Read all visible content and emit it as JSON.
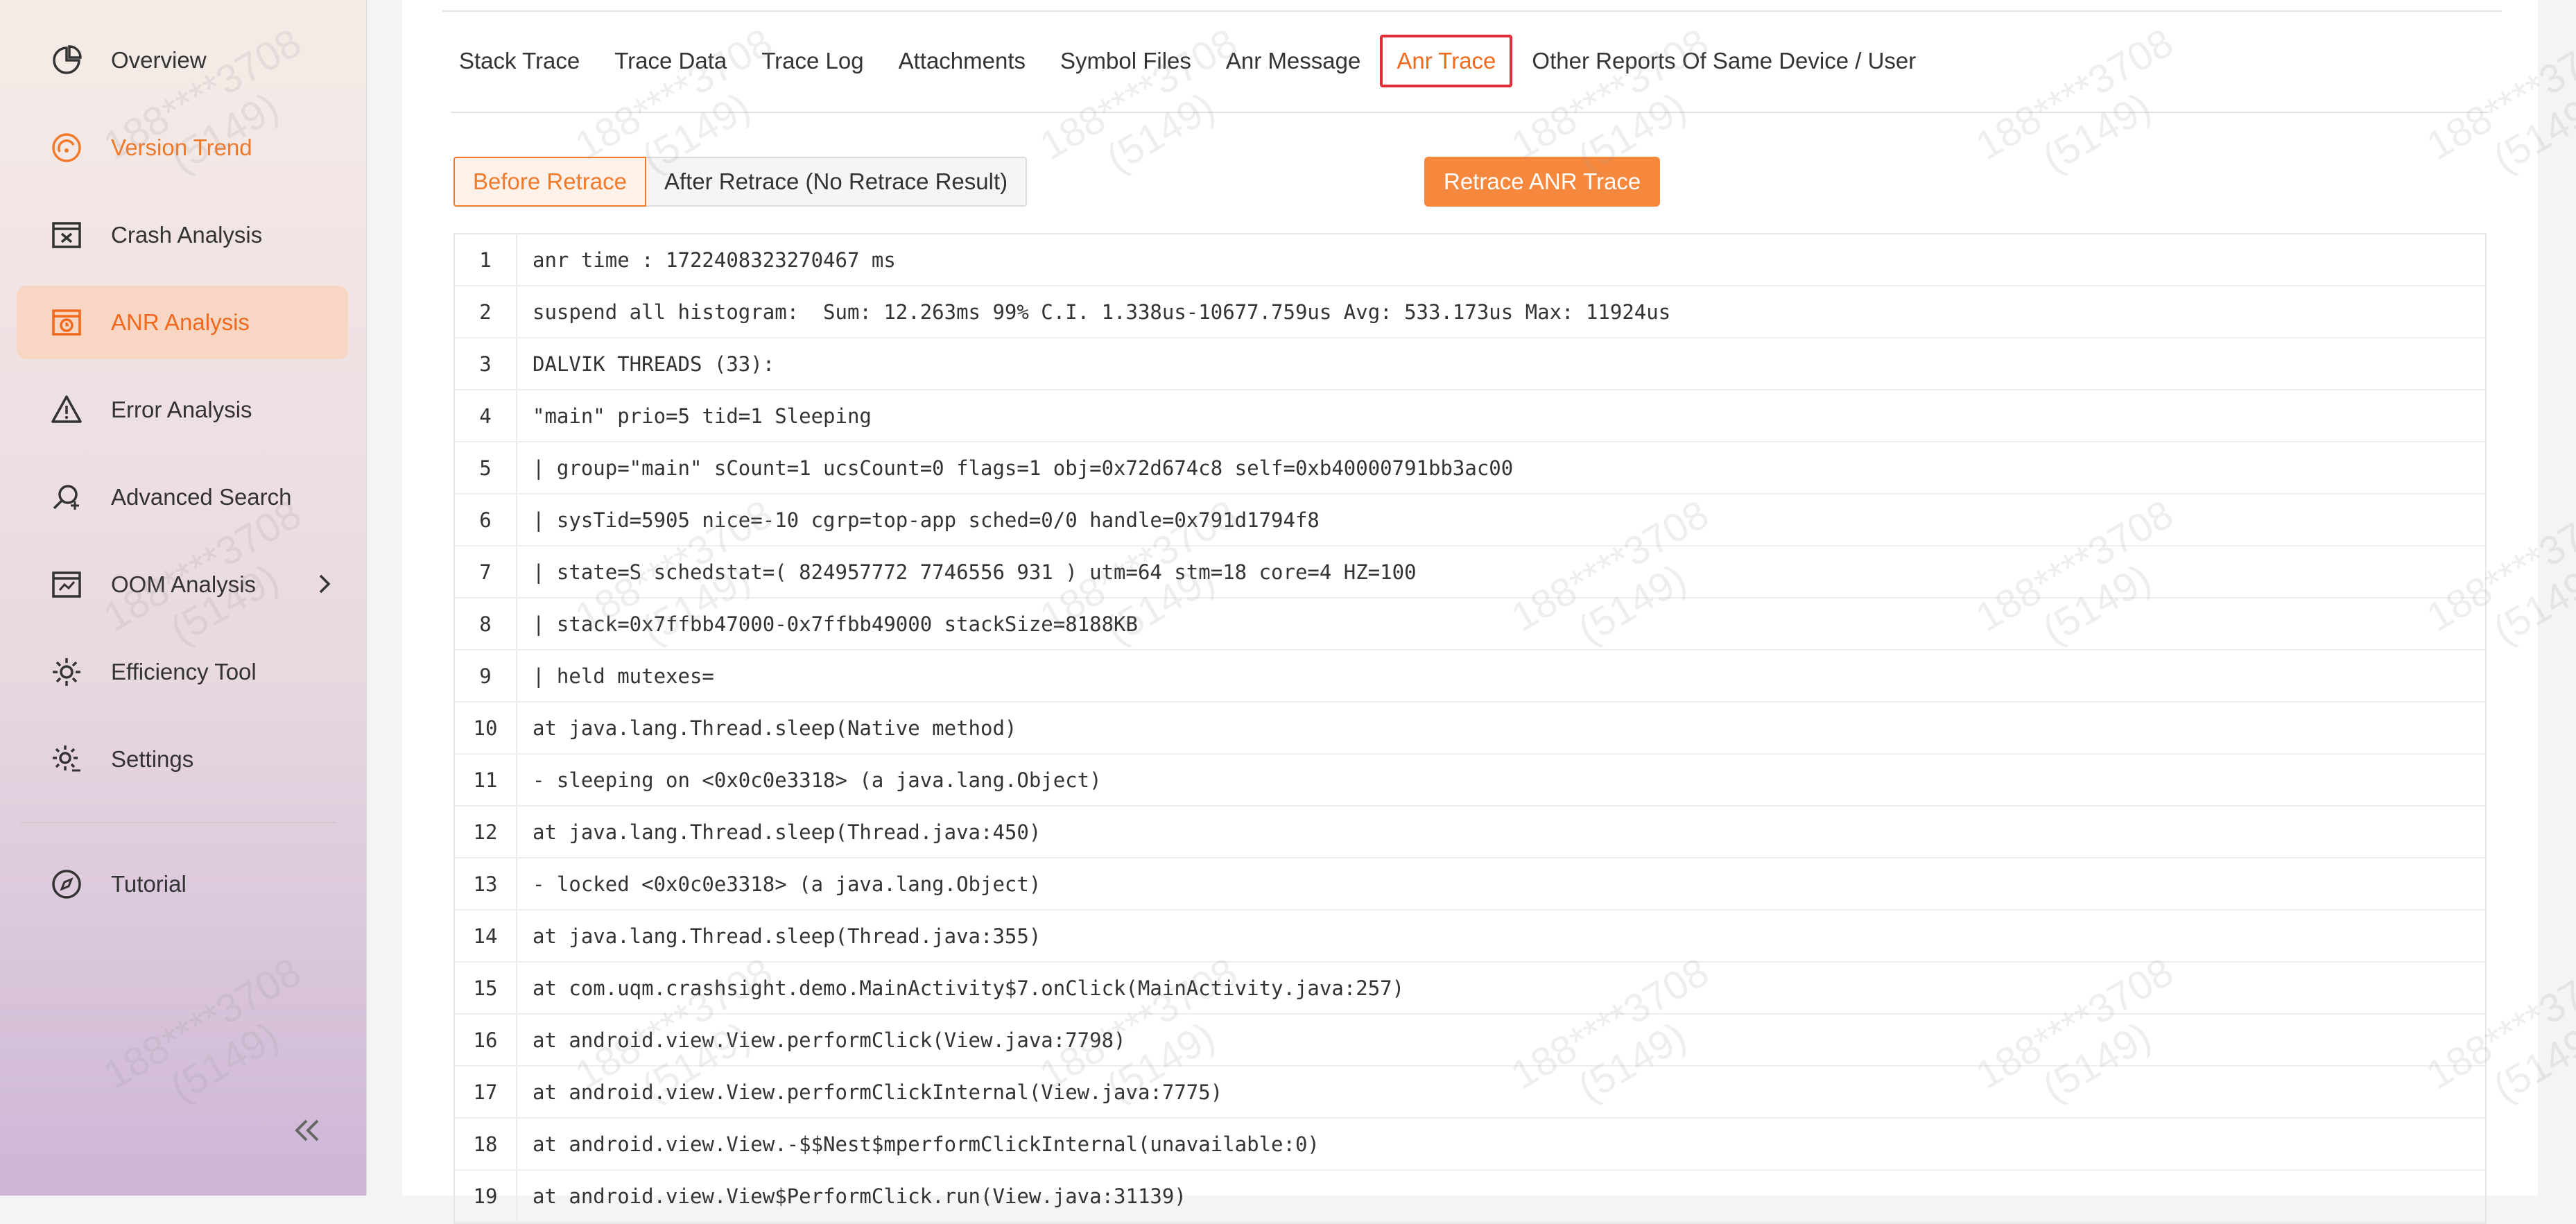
{
  "sidebar": {
    "items": [
      {
        "label": "Overview",
        "icon": "overview-icon"
      },
      {
        "label": "Version Trend",
        "icon": "version-trend-icon"
      },
      {
        "label": "Crash Analysis",
        "icon": "crash-analysis-icon"
      },
      {
        "label": "ANR Analysis",
        "icon": "anr-analysis-icon"
      },
      {
        "label": "Error Analysis",
        "icon": "error-analysis-icon"
      },
      {
        "label": "Advanced Search",
        "icon": "advanced-search-icon"
      },
      {
        "label": "OOM Analysis",
        "icon": "oom-analysis-icon"
      },
      {
        "label": "Efficiency Tool",
        "icon": "efficiency-tool-icon"
      },
      {
        "label": "Settings",
        "icon": "settings-icon"
      },
      {
        "label": "Tutorial",
        "icon": "tutorial-icon"
      }
    ],
    "active_item": "ANR Analysis",
    "collapse_icon": "double-chevron-left-icon"
  },
  "tabs": [
    {
      "label": "Stack Trace"
    },
    {
      "label": "Trace Data"
    },
    {
      "label": "Trace Log"
    },
    {
      "label": "Attachments"
    },
    {
      "label": "Symbol Files"
    },
    {
      "label": "Anr Message"
    },
    {
      "label": "Anr Trace"
    },
    {
      "label": "Other Reports Of Same Device / User"
    }
  ],
  "active_tab": "Anr Trace",
  "buttons": {
    "before_retrace": "Before Retrace",
    "after_retrace": "After Retrace (No Retrace Result)",
    "retrace_anr_trace": "Retrace ANR Trace"
  },
  "code_lines": [
    {
      "n": "1",
      "text": "anr time : 1722408323270467 ms"
    },
    {
      "n": "2",
      "text": "suspend all histogram:  Sum: 12.263ms 99% C.I. 1.338us-10677.759us Avg: 533.173us Max: 11924us"
    },
    {
      "n": "3",
      "text": "DALVIK THREADS (33):"
    },
    {
      "n": "4",
      "text": "\"main\" prio=5 tid=1 Sleeping"
    },
    {
      "n": "5",
      "text": "| group=\"main\" sCount=1 ucsCount=0 flags=1 obj=0x72d674c8 self=0xb40000791bb3ac00"
    },
    {
      "n": "6",
      "text": "| sysTid=5905 nice=-10 cgrp=top-app sched=0/0 handle=0x791d1794f8"
    },
    {
      "n": "7",
      "text": "| state=S schedstat=( 824957772 7746556 931 ) utm=64 stm=18 core=4 HZ=100"
    },
    {
      "n": "8",
      "text": "| stack=0x7ffbb47000-0x7ffbb49000 stackSize=8188KB"
    },
    {
      "n": "9",
      "text": "| held mutexes="
    },
    {
      "n": "10",
      "text": "at java.lang.Thread.sleep(Native method)"
    },
    {
      "n": "11",
      "text": "- sleeping on <0x0c0e3318> (a java.lang.Object)"
    },
    {
      "n": "12",
      "text": "at java.lang.Thread.sleep(Thread.java:450)"
    },
    {
      "n": "13",
      "text": "- locked <0x0c0e3318> (a java.lang.Object)"
    },
    {
      "n": "14",
      "text": "at java.lang.Thread.sleep(Thread.java:355)"
    },
    {
      "n": "15",
      "text": "at com.uqm.crashsight.demo.MainActivity$7.onClick(MainActivity.java:257)"
    },
    {
      "n": "16",
      "text": "at android.view.View.performClick(View.java:7798)"
    },
    {
      "n": "17",
      "text": "at android.view.View.performClickInternal(View.java:7775)"
    },
    {
      "n": "18",
      "text": "at android.view.View.-$$Nest$mperformClickInternal(unavailable:0)"
    },
    {
      "n": "19",
      "text": "at android.view.View$PerformClick.run(View.java:31139)"
    }
  ],
  "watermark": {
    "line1": "188****3708",
    "line2": "(5149)"
  },
  "colors": {
    "accent": "#ef6a1f",
    "active_tab_border": "#e32d3a",
    "retrace_button": "#f5883d"
  }
}
